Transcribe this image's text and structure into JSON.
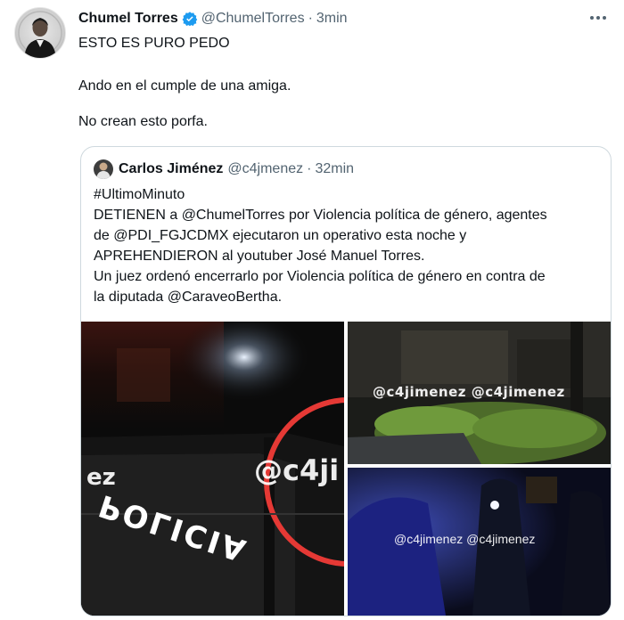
{
  "tweet": {
    "author_name": "Chumel Torres",
    "handle": "@ChumelTorres",
    "separator": "·",
    "time": "3min",
    "text_lines": [
      "ESTO ES PURO PEDO",
      "Ando en el cumple de una amiga.",
      "No crean esto porfa."
    ]
  },
  "quote": {
    "author_name": "Carlos Jiménez",
    "handle": "@c4jmenez",
    "separator": "·",
    "time": "32min",
    "text_lines": [
      "#UltimoMinuto",
      "DETIENEN a @ChumelTorres  por Violencia política de género, agentes",
      "de @PDI_FGJCDMX ejecutaron un operativo esta noche y",
      "APREHENDIERON al youtuber José Manuel Torres.",
      "Un juez ordenó encerrarlo por Violencia política de género en contra de",
      "la diputada @CaraveoBertha."
    ],
    "media": {
      "image1_watermark_left": "ez",
      "image1_watermark_right": "@c4ji",
      "image1_sign_text": "POLICIA",
      "image2_watermark": "@c4jimenez  @c4jimenez",
      "image3_watermark": "@c4jimenez  @c4jimenez"
    }
  },
  "colors": {
    "text": "#0f1419",
    "muted": "#536471",
    "verified": "#1d9bf0",
    "border": "#cfd9de",
    "circle_annotation": "#e53935"
  },
  "icons": {
    "verified": "verified-badge-icon",
    "more": "more-options-icon"
  }
}
